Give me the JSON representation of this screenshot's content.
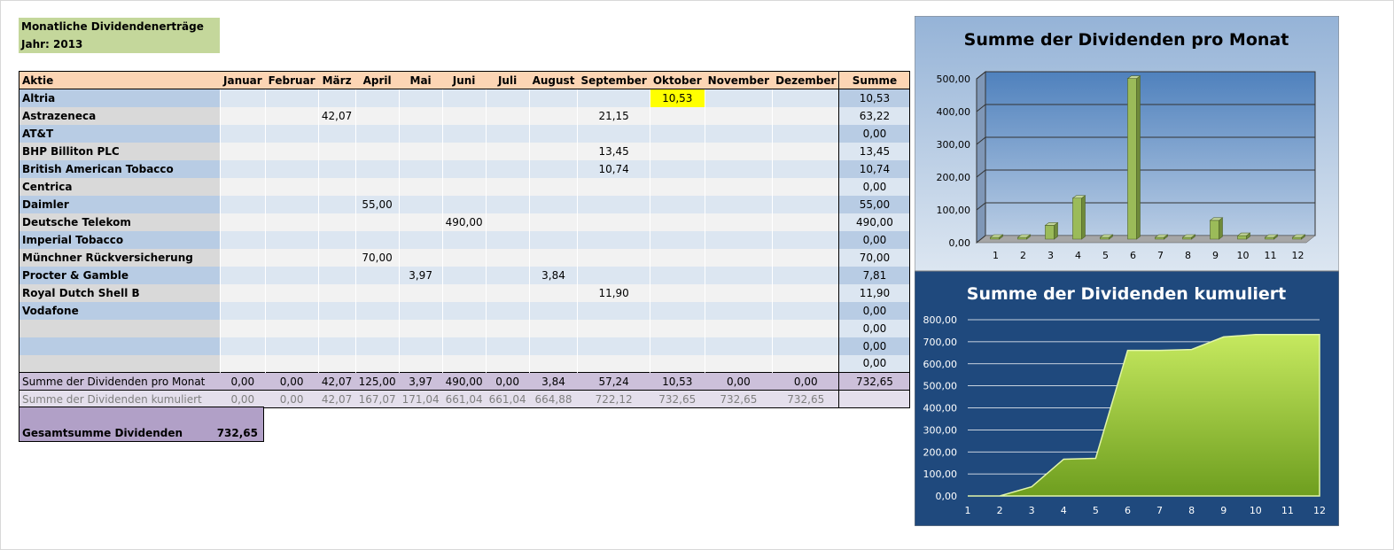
{
  "title": {
    "line1": "Monatliche Dividendenerträge",
    "line2": "Jahr: 2013"
  },
  "table": {
    "header": {
      "first": "Aktie",
      "months": [
        "Januar",
        "Februar",
        "März",
        "April",
        "Mai",
        "Juni",
        "Juli",
        "August",
        "September",
        "Oktober",
        "November",
        "Dezember"
      ],
      "sum": "Summe"
    },
    "rows": [
      {
        "name": "Altria",
        "cells": [
          "",
          "",
          "",
          "",
          "",
          "",
          "",
          "",
          "",
          "10,53",
          "",
          ""
        ],
        "sum": "10,53"
      },
      {
        "name": "Astrazeneca",
        "cells": [
          "",
          "",
          "42,07",
          "",
          "",
          "",
          "",
          "",
          "21,15",
          "",
          "",
          ""
        ],
        "sum": "63,22"
      },
      {
        "name": "AT&T",
        "cells": [
          "",
          "",
          "",
          "",
          "",
          "",
          "",
          "",
          "",
          "",
          "",
          ""
        ],
        "sum": "0,00"
      },
      {
        "name": "BHP Billiton PLC",
        "cells": [
          "",
          "",
          "",
          "",
          "",
          "",
          "",
          "",
          "13,45",
          "",
          "",
          ""
        ],
        "sum": "13,45"
      },
      {
        "name": "British American Tobacco",
        "cells": [
          "",
          "",
          "",
          "",
          "",
          "",
          "",
          "",
          "10,74",
          "",
          "",
          ""
        ],
        "sum": "10,74"
      },
      {
        "name": "Centrica",
        "cells": [
          "",
          "",
          "",
          "",
          "",
          "",
          "",
          "",
          "",
          "",
          "",
          ""
        ],
        "sum": "0,00"
      },
      {
        "name": "Daimler",
        "cells": [
          "",
          "",
          "",
          "55,00",
          "",
          "",
          "",
          "",
          "",
          "",
          "",
          ""
        ],
        "sum": "55,00"
      },
      {
        "name": "Deutsche Telekom",
        "cells": [
          "",
          "",
          "",
          "",
          "",
          "490,00",
          "",
          "",
          "",
          "",
          "",
          ""
        ],
        "sum": "490,00"
      },
      {
        "name": "Imperial Tobacco",
        "cells": [
          "",
          "",
          "",
          "",
          "",
          "",
          "",
          "",
          "",
          "",
          "",
          ""
        ],
        "sum": "0,00"
      },
      {
        "name": "Münchner Rückversicherung",
        "cells": [
          "",
          "",
          "",
          "70,00",
          "",
          "",
          "",
          "",
          "",
          "",
          "",
          ""
        ],
        "sum": "70,00"
      },
      {
        "name": "Procter & Gamble",
        "cells": [
          "",
          "",
          "",
          "",
          "3,97",
          "",
          "",
          "3,84",
          "",
          "",
          "",
          ""
        ],
        "sum": "7,81"
      },
      {
        "name": "Royal Dutch Shell B",
        "cells": [
          "",
          "",
          "",
          "",
          "",
          "",
          "",
          "",
          "11,90",
          "",
          "",
          ""
        ],
        "sum": "11,90"
      },
      {
        "name": "Vodafone",
        "cells": [
          "",
          "",
          "",
          "",
          "",
          "",
          "",
          "",
          "",
          "",
          "",
          ""
        ],
        "sum": "0,00"
      },
      {
        "name": "",
        "cells": [
          "",
          "",
          "",
          "",
          "",
          "",
          "",
          "",
          "",
          "",
          "",
          ""
        ],
        "sum": "0,00"
      },
      {
        "name": "",
        "cells": [
          "",
          "",
          "",
          "",
          "",
          "",
          "",
          "",
          "",
          "",
          "",
          ""
        ],
        "sum": "0,00"
      },
      {
        "name": "",
        "cells": [
          "",
          "",
          "",
          "",
          "",
          "",
          "",
          "",
          "",
          "",
          "",
          ""
        ],
        "sum": "0,00"
      }
    ],
    "monthly_total": {
      "label": "Summe der Dividenden pro Monat",
      "cells": [
        "0,00",
        "0,00",
        "42,07",
        "125,00",
        "3,97",
        "490,00",
        "0,00",
        "3,84",
        "57,24",
        "10,53",
        "0,00",
        "0,00"
      ],
      "sum": "732,65"
    },
    "cumulative": {
      "label": "Summe der Dividenden kumuliert",
      "cells": [
        "0,00",
        "0,00",
        "42,07",
        "167,07",
        "171,04",
        "661,04",
        "661,04",
        "664,88",
        "722,12",
        "732,65",
        "732,65",
        "732,65"
      ],
      "sum": ""
    },
    "grand_total": {
      "label": "Gesamtsumme Dividenden",
      "value": "732,65"
    },
    "highlight_color": "#ffff00"
  },
  "chart_data": [
    {
      "type": "bar",
      "title": "Summe der Dividenden pro Monat",
      "categories": [
        "1",
        "2",
        "3",
        "4",
        "5",
        "6",
        "7",
        "8",
        "9",
        "10",
        "11",
        "12"
      ],
      "values": [
        0,
        0,
        42.07,
        125.0,
        3.97,
        490.0,
        0,
        3.84,
        57.24,
        10.53,
        0,
        0
      ],
      "ylim": [
        0,
        500
      ],
      "yticks": [
        "0,00",
        "100,00",
        "200,00",
        "300,00",
        "400,00",
        "500,00"
      ],
      "grid": true,
      "bar_color": "#9bbb59",
      "background": "#b8cce4"
    },
    {
      "type": "area",
      "title": "Summe der Dividenden kumuliert",
      "categories": [
        "1",
        "2",
        "3",
        "4",
        "5",
        "6",
        "7",
        "8",
        "9",
        "10",
        "11",
        "12"
      ],
      "values": [
        0,
        0,
        42.07,
        167.07,
        171.04,
        661.04,
        661.04,
        664.88,
        722.12,
        732.65,
        732.65,
        732.65
      ],
      "ylim": [
        0,
        800
      ],
      "yticks": [
        "0,00",
        "100,00",
        "200,00",
        "300,00",
        "400,00",
        "500,00",
        "600,00",
        "700,00",
        "800,00"
      ],
      "grid": true,
      "area_color": "#9bd32e",
      "background": "#1f497d"
    }
  ]
}
